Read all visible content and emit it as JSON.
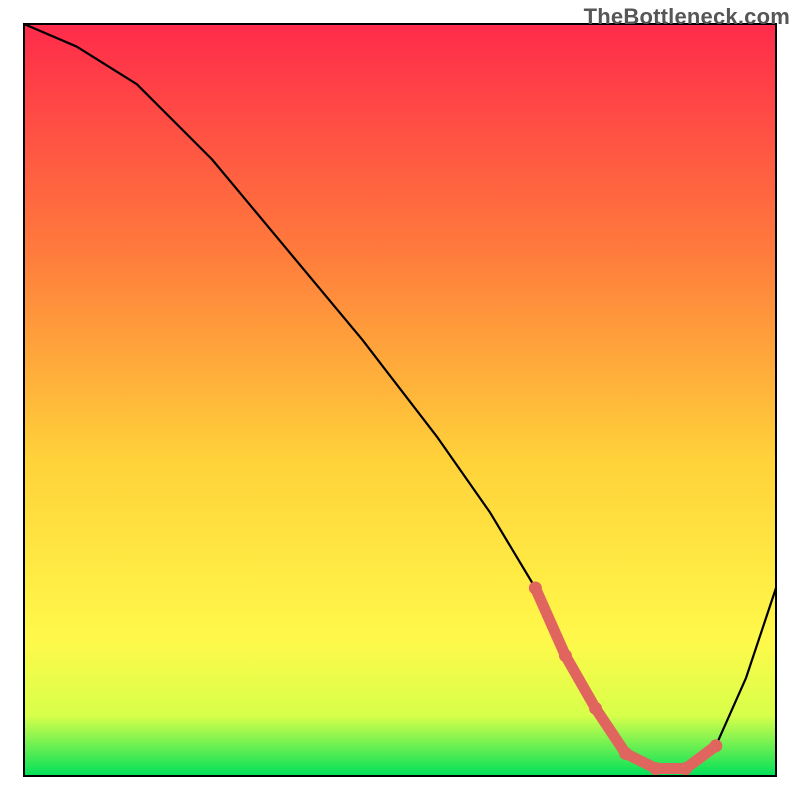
{
  "watermark": "TheBottleneck.com",
  "colors": {
    "gradient_top": "#ff2b4b",
    "gradient_mid1": "#ff7a3c",
    "gradient_mid2": "#ffd23a",
    "gradient_mid3": "#fff94a",
    "gradient_bottom": "#00e05a",
    "curve": "#000000",
    "highlight": "#e0655f",
    "frame": "#000000"
  },
  "chart_data": {
    "type": "line",
    "title": "",
    "xlabel": "",
    "ylabel": "",
    "xlim": [
      0,
      100
    ],
    "ylim": [
      0,
      100
    ],
    "grid": false,
    "legend": false,
    "series": [
      {
        "name": "bottleneck-curve",
        "x": [
          0,
          7,
          15,
          25,
          35,
          45,
          55,
          62,
          68,
          72,
          76,
          80,
          84,
          88,
          92,
          96,
          100
        ],
        "values": [
          100,
          97,
          92,
          82,
          70,
          58,
          45,
          35,
          25,
          16,
          9,
          3,
          1,
          1,
          4,
          13,
          25
        ]
      }
    ],
    "highlight_segment": {
      "x": [
        68,
        72,
        76,
        80,
        84,
        88,
        92
      ],
      "values": [
        25,
        16,
        9,
        3,
        1,
        1,
        4
      ]
    },
    "annotations": []
  }
}
